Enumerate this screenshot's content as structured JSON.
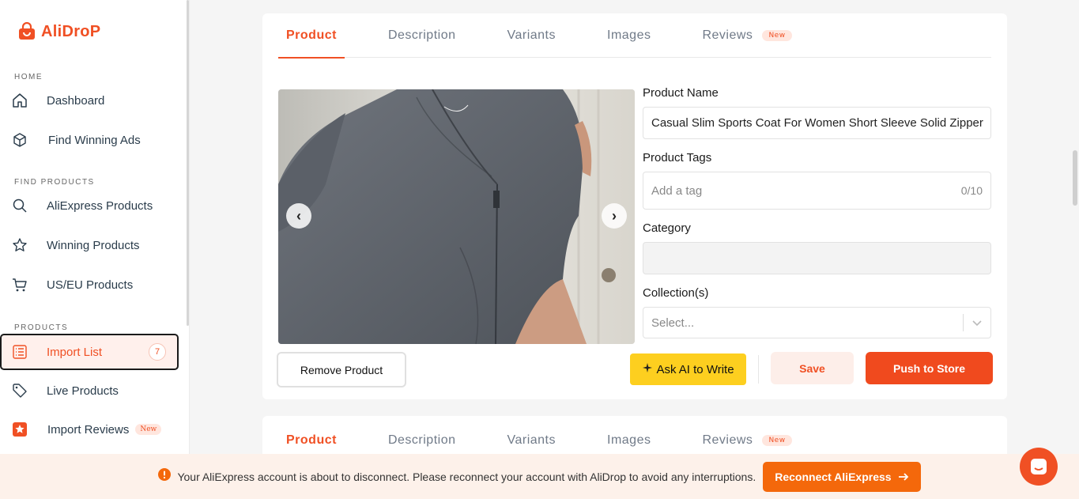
{
  "brand": {
    "name": "AliDroP",
    "accent": "#f05024"
  },
  "sidebar": {
    "sections": [
      {
        "label": "HOME"
      },
      {
        "label": "FIND PRODUCTS"
      },
      {
        "label": "PRODUCTS"
      }
    ],
    "items": [
      {
        "label": "Dashboard",
        "icon": "home-icon"
      },
      {
        "label": "Find Winning Ads",
        "icon": "cube-icon"
      },
      {
        "label": "AliExpress Products",
        "icon": "search-icon"
      },
      {
        "label": "Winning Products",
        "icon": "star-icon"
      },
      {
        "label": "US/EU Products",
        "icon": "cart-icon"
      },
      {
        "label": "Import List",
        "icon": "list-icon",
        "count": "7"
      },
      {
        "label": "Live Products",
        "icon": "tag-icon"
      },
      {
        "label": "Import Reviews",
        "icon": "review-star-icon",
        "badge": "New"
      }
    ]
  },
  "tabs": [
    {
      "label": "Product"
    },
    {
      "label": "Description"
    },
    {
      "label": "Variants"
    },
    {
      "label": "Images"
    },
    {
      "label": "Reviews",
      "badge": "New"
    }
  ],
  "product": {
    "name_label": "Product Name",
    "name_value": "Casual Slim Sports Coat For Women Short Sleeve Solid Zipper",
    "tags_label": "Product Tags",
    "tags_placeholder": "Add a tag",
    "tags_count": "0/10",
    "category_label": "Category",
    "category_value": "",
    "collections_label": "Collection(s)",
    "collections_placeholder": "Select..."
  },
  "actions": {
    "remove": "Remove Product",
    "ask_ai": "Ask AI to Write",
    "save": "Save",
    "push": "Push to Store"
  },
  "banner": {
    "message": "Your AliExpress account is about to disconnect. Please reconnect your account with AliDrop to avoid any interruptions.",
    "button": "Reconnect AliExpress"
  }
}
